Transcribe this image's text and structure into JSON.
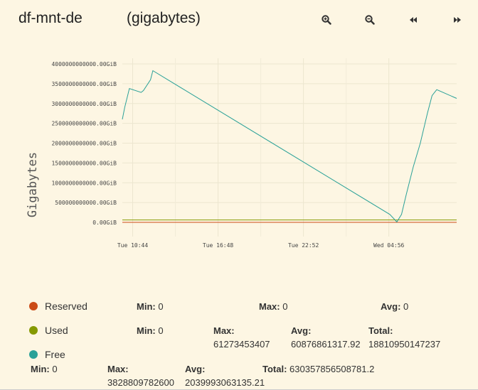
{
  "header": {
    "title": "df-mnt-de",
    "subtitle": "(gigabytes)"
  },
  "toolbar": {
    "zoom_in_icon": "zoom-in-icon",
    "zoom_out_icon": "zoom-out-icon",
    "back_icon": "rewind-icon",
    "forward_icon": "fast-forward-icon"
  },
  "chart_data": {
    "type": "line",
    "ylabel": "Gigabytes",
    "yticks": [
      "4000000000000.00GiB",
      "3500000000000.00GiB",
      "3000000000000.00GiB",
      "2500000000000.00GiB",
      "2000000000000.00GiB",
      "1500000000000.00GiB",
      "1000000000000.00GiB",
      "500000000000.00GiB",
      "0.00GiB"
    ],
    "ylim": [
      0,
      4000000000000
    ],
    "xticks": [
      "Tue 10:44",
      "Tue 16:48",
      "Tue 22:52",
      "Wed 04:56"
    ],
    "xlim": [
      "Tue 10:00",
      "Wed 09:45"
    ],
    "grid": true,
    "series": [
      {
        "name": "Reserved",
        "color": "#cb4b16",
        "x": [
          "Tue 10:00",
          "Wed 09:45"
        ],
        "values": [
          0,
          0
        ]
      },
      {
        "name": "Used",
        "color": "#859900",
        "x": [
          "Tue 10:00",
          "Wed 09:45"
        ],
        "values": [
          61273453407,
          61273453407
        ]
      },
      {
        "name": "Free",
        "color": "#2aa198",
        "x": [
          "Tue 10:00",
          "Tue 10:10",
          "Tue 10:30",
          "Tue 11:20",
          "Tue 11:30",
          "Tue 12:00",
          "Tue 12:10",
          "Wed 05:00",
          "Wed 05:30",
          "Wed 05:50",
          "Wed 06:10",
          "Wed 06:40",
          "Wed 07:10",
          "Wed 07:40",
          "Wed 08:00",
          "Wed 08:20",
          "Wed 09:45"
        ],
        "values": [
          2600000000000,
          2900000000000,
          3380000000000,
          3280000000000,
          3330000000000,
          3600000000000,
          3830000000000,
          200000000000,
          10000000000,
          200000000000,
          700000000000,
          1400000000000,
          2000000000000,
          2750000000000,
          3200000000000,
          3350000000000,
          3130000000000
        ]
      }
    ]
  },
  "legend": [
    {
      "name": "Reserved",
      "color": "#cb4b16",
      "stats": [
        {
          "label": "Min:",
          "value": "0"
        },
        {
          "label": "Max:",
          "value": "0"
        },
        {
          "label": "Avg:",
          "value": "0"
        }
      ]
    },
    {
      "name": "Used",
      "color": "#859900",
      "stats": [
        {
          "label": "Min:",
          "value": "0"
        },
        {
          "label": "Max:",
          "value": "61273453407"
        },
        {
          "label": "Avg:",
          "value": "60876861317.92"
        },
        {
          "label": "Total:",
          "value": "18810950147237"
        }
      ]
    },
    {
      "name": "Free",
      "color": "#2aa198",
      "stats": [
        {
          "label": "Min:",
          "value": "0"
        },
        {
          "label": "Max:",
          "value": "3828809782600"
        },
        {
          "label": "Avg:",
          "value": "2039993063135.21"
        },
        {
          "label": "Total:",
          "value": "630357856508781.2"
        }
      ]
    }
  ]
}
